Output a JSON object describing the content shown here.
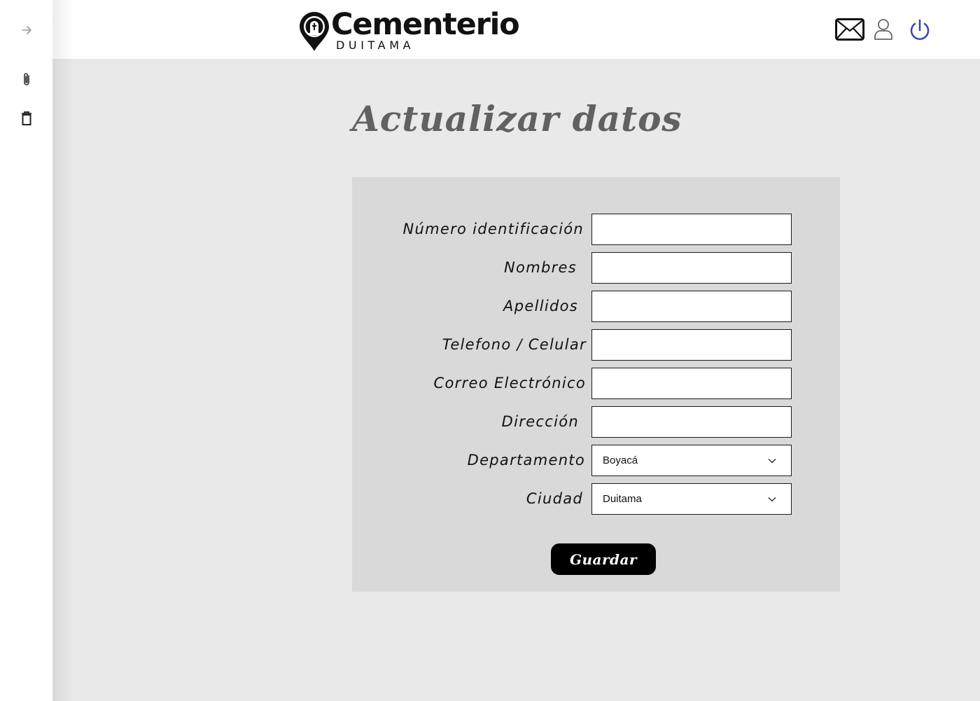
{
  "header": {
    "logo_title": "Cementerio",
    "logo_subtitle": "DUITAMA",
    "icons": [
      "mail-icon",
      "user-icon",
      "power-icon"
    ]
  },
  "sidebar": {
    "items": [
      "arrow-right-icon",
      "paperclip-icon",
      "trash-icon"
    ]
  },
  "page": {
    "title": "Actualizar datos"
  },
  "form": {
    "fields": [
      {
        "label": "Número identificación",
        "value": ""
      },
      {
        "label": "Nombres",
        "value": ""
      },
      {
        "label": "Apellidos",
        "value": ""
      },
      {
        "label": "Telefono / Celular",
        "value": ""
      },
      {
        "label": "Correo Electrónico",
        "value": ""
      },
      {
        "label": "Dirección",
        "value": ""
      }
    ],
    "departamento": {
      "label": "Departamento",
      "value": "Boyacá"
    },
    "ciudad": {
      "label": "Ciudad",
      "value": "Duitama"
    },
    "save_label": "Guardar"
  },
  "colors": {
    "main_bg": "#e9e9e9",
    "panel_bg": "#d9d9d9",
    "title": "#616161",
    "power_icon": "#3b4aa3"
  }
}
